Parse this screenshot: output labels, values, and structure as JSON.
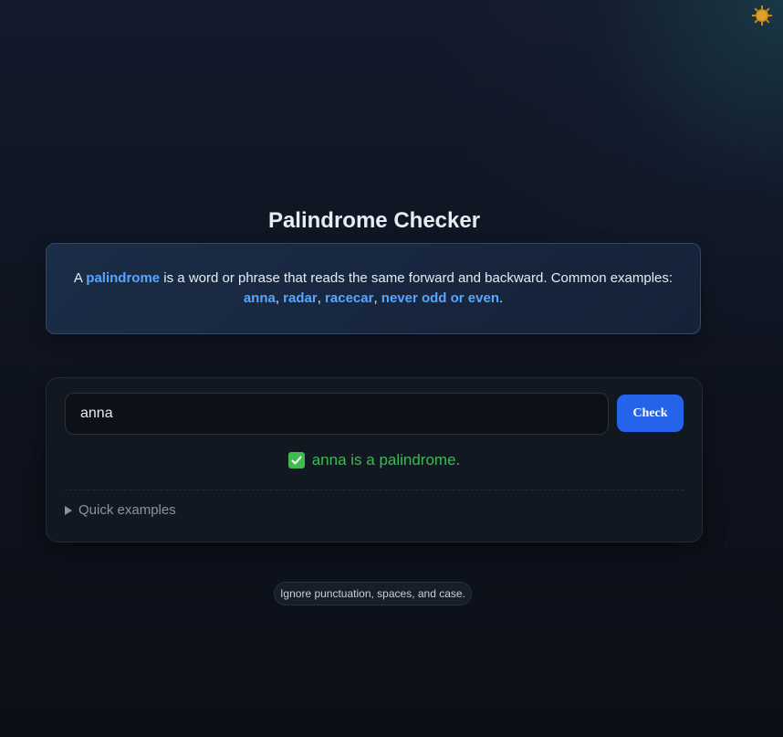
{
  "theme_toggle": {
    "icon": "sun-icon",
    "color": "#c8871f"
  },
  "title": "Palindrome Checker",
  "info": {
    "prefix": "A ",
    "term": "palindrome",
    "middle": " is a word or phrase that reads the same forward and backward. Common examples:",
    "examples": [
      "anna",
      "radar",
      "racecar",
      "never odd or even"
    ],
    "separator": ", ",
    "suffix": "."
  },
  "input": {
    "value": "anna",
    "placeholder": ""
  },
  "check_button": {
    "label": "Check"
  },
  "result": {
    "icon": "checkbox-checked-icon",
    "text": "anna is a palindrome.",
    "color": "#3fb950"
  },
  "quick_examples": {
    "label": "Quick examples",
    "icon": "triangle-right-icon"
  },
  "hint": "Ignore punctuation, spaces, and case.",
  "colors": {
    "accent": "#2563eb",
    "link": "#58a6ff",
    "success": "#3fb950"
  }
}
